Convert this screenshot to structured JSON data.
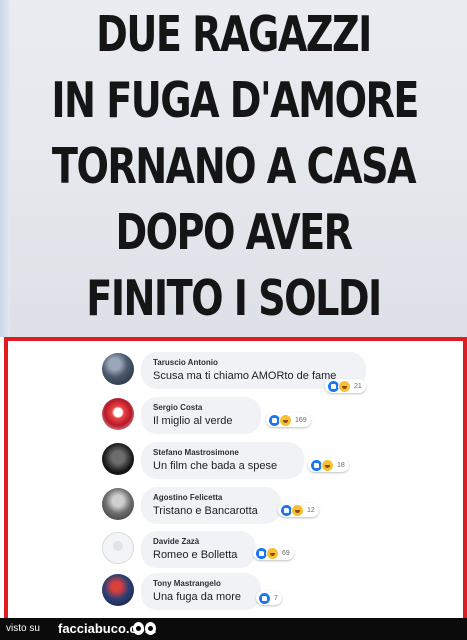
{
  "headline": {
    "lines": [
      "DUE RAGAZZI",
      "IN FUGA D'AMORE",
      "TORNANO A CASA",
      "DOPO AVER",
      "FINITO I SOLDI"
    ]
  },
  "comments": [
    {
      "author": "Taruscio Antonio",
      "text": "Scusa ma ti chiamo AMORto de fame",
      "reactions": [
        "like-icon",
        "haha-icon"
      ],
      "count": "21"
    },
    {
      "author": "Sergio Costa",
      "text": "Il miglio al verde",
      "reactions": [
        "like-icon",
        "haha-icon"
      ],
      "count": "169"
    },
    {
      "author": "Stefano Mastrosimone",
      "text": "Un film che bada a spese",
      "reactions": [
        "like-icon",
        "haha-icon"
      ],
      "count": "18"
    },
    {
      "author": "Agostino Felicetta",
      "text": "Tristano e Bancarotta",
      "reactions": [
        "like-icon",
        "haha-icon"
      ],
      "count": "12"
    },
    {
      "author": "Davide Zazà",
      "text": "Romeo e Bolletta",
      "reactions": [
        "like-icon",
        "haha-icon"
      ],
      "count": "69"
    },
    {
      "author": "Tony Mastrangelo",
      "text": "Una fuga da more",
      "reactions": [
        "like-icon"
      ],
      "count": "7"
    }
  ],
  "footer": {
    "visto_su": "visto su",
    "brand": "facciabuco.com"
  },
  "colors": {
    "frame": "#e11b22",
    "like": "#1877f2",
    "haha": "#f7c034",
    "bubble": "#f0f2f5"
  }
}
